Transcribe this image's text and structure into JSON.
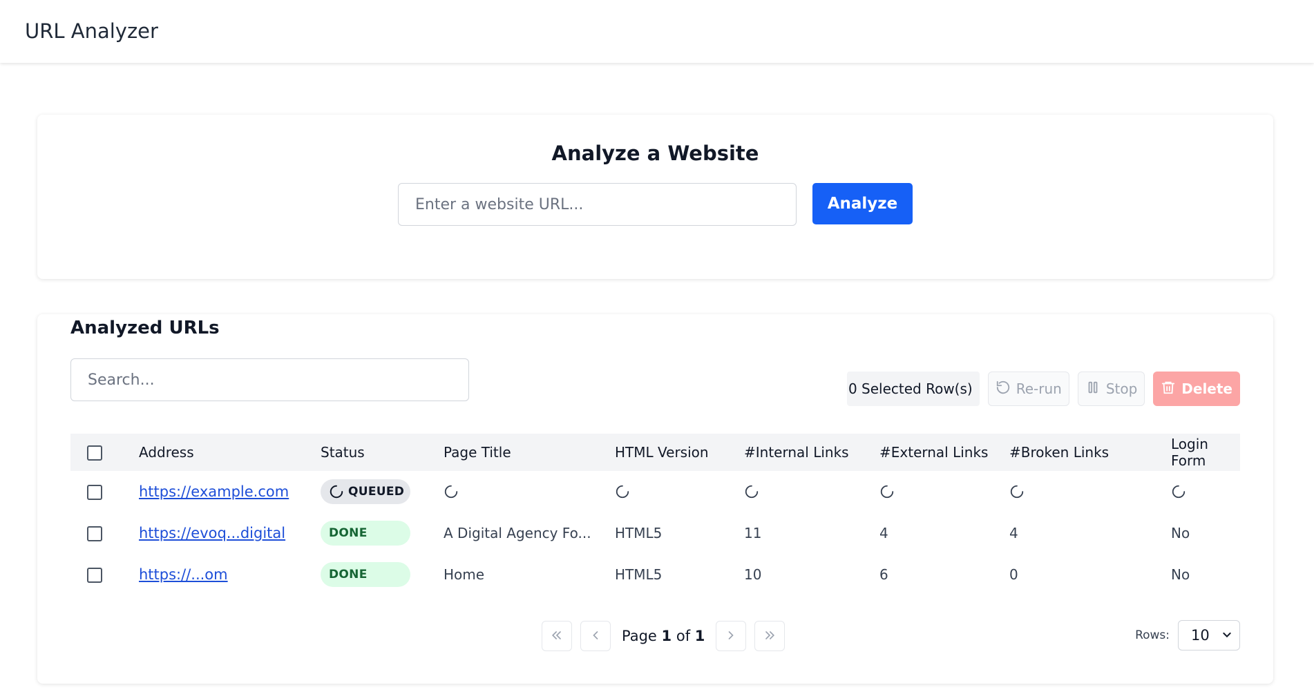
{
  "app": {
    "title": "URL Analyzer"
  },
  "analyze": {
    "heading": "Analyze a Website",
    "url_placeholder": "Enter a website URL...",
    "analyze_label": "Analyze"
  },
  "urls": {
    "heading": "Analyzed URLs",
    "search_placeholder": "Search...",
    "selected_text": "0 Selected Row(s)",
    "rerun_label": "Re-run",
    "stop_label": "Stop",
    "delete_label": "Delete",
    "columns": [
      "Address",
      "Status",
      "Page Title",
      "HTML Version",
      "#Internal Links",
      "#External Links",
      "#Broken Links",
      "Login Form"
    ],
    "rows": [
      {
        "address": "https://example.com",
        "status": "QUEUED",
        "title": "",
        "html": "",
        "internal": "",
        "external": "",
        "broken": "",
        "login": ""
      },
      {
        "address": "https://evoq...digital",
        "status": "DONE",
        "title": "A Digital Agency Fo...",
        "html": "HTML5",
        "internal": "11",
        "external": "4",
        "broken": "4",
        "login": "No"
      },
      {
        "address": "https://...om",
        "status": "DONE",
        "title": "Home",
        "html": "HTML5",
        "internal": "10",
        "external": "6",
        "broken": "0",
        "login": "No"
      }
    ]
  },
  "pagination": {
    "page_word": "Page",
    "current": "1",
    "of_word": "of",
    "total": "1",
    "rows_label": "Rows:",
    "rows_value": "10"
  },
  "colors": {
    "primary": "#1660f6",
    "delete": "#fca5a5",
    "done_bg": "#dcfce7",
    "done_text": "#166534",
    "queued_bg": "#e5e7eb",
    "link": "#1d4ed8"
  }
}
